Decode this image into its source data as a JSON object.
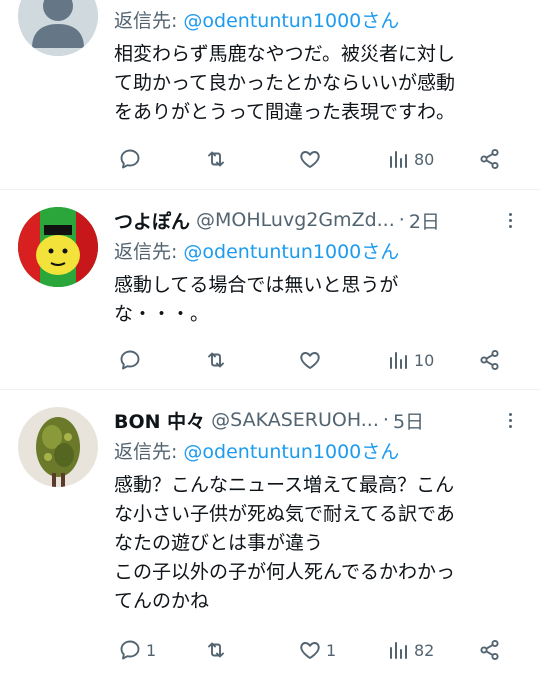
{
  "tweets": [
    {
      "display_name": "",
      "handle": "",
      "time": "",
      "reply_prefix": "返信先:",
      "reply_to": "@odentuntun1000さん",
      "text_lines": [
        "相変わらず馬鹿なやつだ。被災者に対し",
        "て助かって良かったとかならいいが感動",
        "をありがとうって間違った表現ですわ。"
      ],
      "replies": "",
      "retweets": "",
      "likes": "",
      "views": "80",
      "avatar": "default-person"
    },
    {
      "display_name": "つよぽん",
      "handle": "@MOHLuvg2GmZd...",
      "time": "2日",
      "reply_prefix": "返信先:",
      "reply_to": "@odentuntun1000さん",
      "text_lines": [
        "感動してる場合では無いと思うが",
        "な・・・。"
      ],
      "replies": "",
      "retweets": "",
      "likes": "",
      "views": "10",
      "avatar": "yellow-character"
    },
    {
      "display_name": "BON 中々",
      "handle": "@SAKASERUOH...",
      "time": "5日",
      "reply_prefix": "返信先:",
      "reply_to": "@odentuntun1000さん",
      "text_lines": [
        "感動？こんなニュース増えて最高？こん",
        "な小さい子供が死ぬ気で耐えてる訳であ",
        "なたの遊びとは事が違う",
        "この子以外の子が何人死んでるかわかっ",
        "てんのかね"
      ],
      "replies": "1",
      "retweets": "",
      "likes": "1",
      "views": "82",
      "avatar": "foliage-figure"
    }
  ],
  "icons": {
    "reply": "reply-icon",
    "retweet": "retweet-icon",
    "like": "like-icon",
    "views": "views-icon",
    "share": "share-icon",
    "more": "more-icon"
  },
  "colors": {
    "text": "#0f1419",
    "secondary": "#536471",
    "link": "#1d9bf0",
    "divider": "#eff3f4"
  }
}
